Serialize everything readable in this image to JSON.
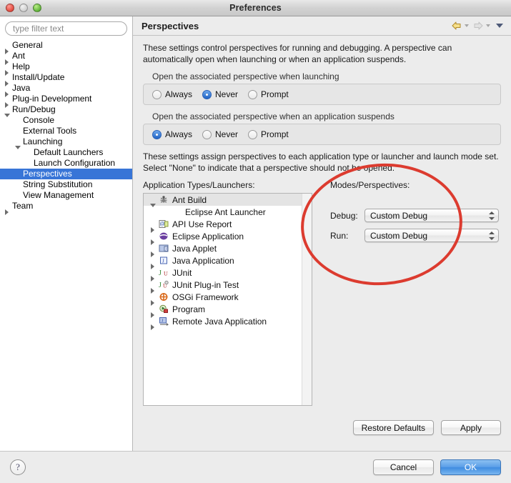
{
  "window": {
    "title": "Preferences",
    "traffic_lights": [
      "close",
      "minimize",
      "zoom"
    ]
  },
  "sidebar": {
    "filter": {
      "placeholder": "type filter text",
      "value": ""
    },
    "items": [
      {
        "label": "General",
        "indent": 0,
        "twisty": "collapsed",
        "selected": false
      },
      {
        "label": "Ant",
        "indent": 0,
        "twisty": "collapsed",
        "selected": false
      },
      {
        "label": "Help",
        "indent": 0,
        "twisty": "collapsed",
        "selected": false
      },
      {
        "label": "Install/Update",
        "indent": 0,
        "twisty": "collapsed",
        "selected": false
      },
      {
        "label": "Java",
        "indent": 0,
        "twisty": "collapsed",
        "selected": false
      },
      {
        "label": "Plug-in Development",
        "indent": 0,
        "twisty": "collapsed",
        "selected": false
      },
      {
        "label": "Run/Debug",
        "indent": 0,
        "twisty": "expanded",
        "selected": false
      },
      {
        "label": "Console",
        "indent": 1,
        "twisty": "none",
        "selected": false
      },
      {
        "label": "External Tools",
        "indent": 1,
        "twisty": "none",
        "selected": false
      },
      {
        "label": "Launching",
        "indent": 1,
        "twisty": "expanded",
        "selected": false
      },
      {
        "label": "Default Launchers",
        "indent": 2,
        "twisty": "none",
        "selected": false
      },
      {
        "label": "Launch Configuration",
        "indent": 2,
        "twisty": "none",
        "selected": false
      },
      {
        "label": "Perspectives",
        "indent": 1,
        "twisty": "none",
        "selected": true
      },
      {
        "label": "String Substitution",
        "indent": 1,
        "twisty": "none",
        "selected": false
      },
      {
        "label": "View Management",
        "indent": 1,
        "twisty": "none",
        "selected": false
      },
      {
        "label": "Team",
        "indent": 0,
        "twisty": "collapsed",
        "selected": false
      }
    ]
  },
  "page": {
    "title": "Perspectives",
    "toolbar": {
      "back_icon": "back-arrow-icon",
      "forward_icon": "forward-arrow-icon",
      "menu_icon": "view-menu-icon"
    },
    "description": "These settings control perspectives for running and debugging. A perspective can automatically open when launching or when an application suspends.",
    "groups": [
      {
        "label": "Open the associated perspective when launching",
        "options": [
          "Always",
          "Never",
          "Prompt"
        ],
        "selected": "Never"
      },
      {
        "label": "Open the associated perspective when an application suspends",
        "options": [
          "Always",
          "Never",
          "Prompt"
        ],
        "selected": "Always"
      }
    ],
    "assign_description": "These settings assign perspectives to each application type or launcher and launch mode set. Select \"None\" to indicate that a perspective should not be opened.",
    "list_label": "Application Types/Launchers:",
    "app_list": [
      {
        "label": "Ant Build",
        "indent": 0,
        "twisty": "expanded",
        "icon": "ant-build-icon",
        "selected": true
      },
      {
        "label": "Eclipse Ant Launcher",
        "indent": 1,
        "twisty": "none",
        "icon": "none",
        "selected": false
      },
      {
        "label": "API Use Report",
        "indent": 0,
        "twisty": "collapsed",
        "icon": "api-use-report-icon",
        "selected": false
      },
      {
        "label": "Eclipse Application",
        "indent": 0,
        "twisty": "collapsed",
        "icon": "eclipse-application-icon",
        "selected": false
      },
      {
        "label": "Java Applet",
        "indent": 0,
        "twisty": "collapsed",
        "icon": "java-applet-icon",
        "selected": false
      },
      {
        "label": "Java Application",
        "indent": 0,
        "twisty": "collapsed",
        "icon": "java-application-icon",
        "selected": false
      },
      {
        "label": "JUnit",
        "indent": 0,
        "twisty": "collapsed",
        "icon": "junit-icon",
        "selected": false
      },
      {
        "label": "JUnit Plug-in Test",
        "indent": 0,
        "twisty": "collapsed",
        "icon": "junit-plugin-test-icon",
        "selected": false
      },
      {
        "label": "OSGi Framework",
        "indent": 0,
        "twisty": "collapsed",
        "icon": "osgi-framework-icon",
        "selected": false
      },
      {
        "label": "Program",
        "indent": 0,
        "twisty": "collapsed",
        "icon": "program-icon",
        "selected": false
      },
      {
        "label": "Remote Java Application",
        "indent": 0,
        "twisty": "collapsed",
        "icon": "remote-java-application-icon",
        "selected": false
      }
    ],
    "modes_label": "Modes/Perspectives:",
    "modes": [
      {
        "label": "Debug:",
        "value": "Custom Debug"
      },
      {
        "label": "Run:",
        "value": "Custom Debug"
      }
    ],
    "restore_defaults_label": "Restore Defaults",
    "apply_label": "Apply"
  },
  "footer": {
    "help_label": "?",
    "cancel_label": "Cancel",
    "ok_label": "OK"
  },
  "annotation": {
    "shape": "ellipse",
    "color": "#dc3b2f"
  }
}
